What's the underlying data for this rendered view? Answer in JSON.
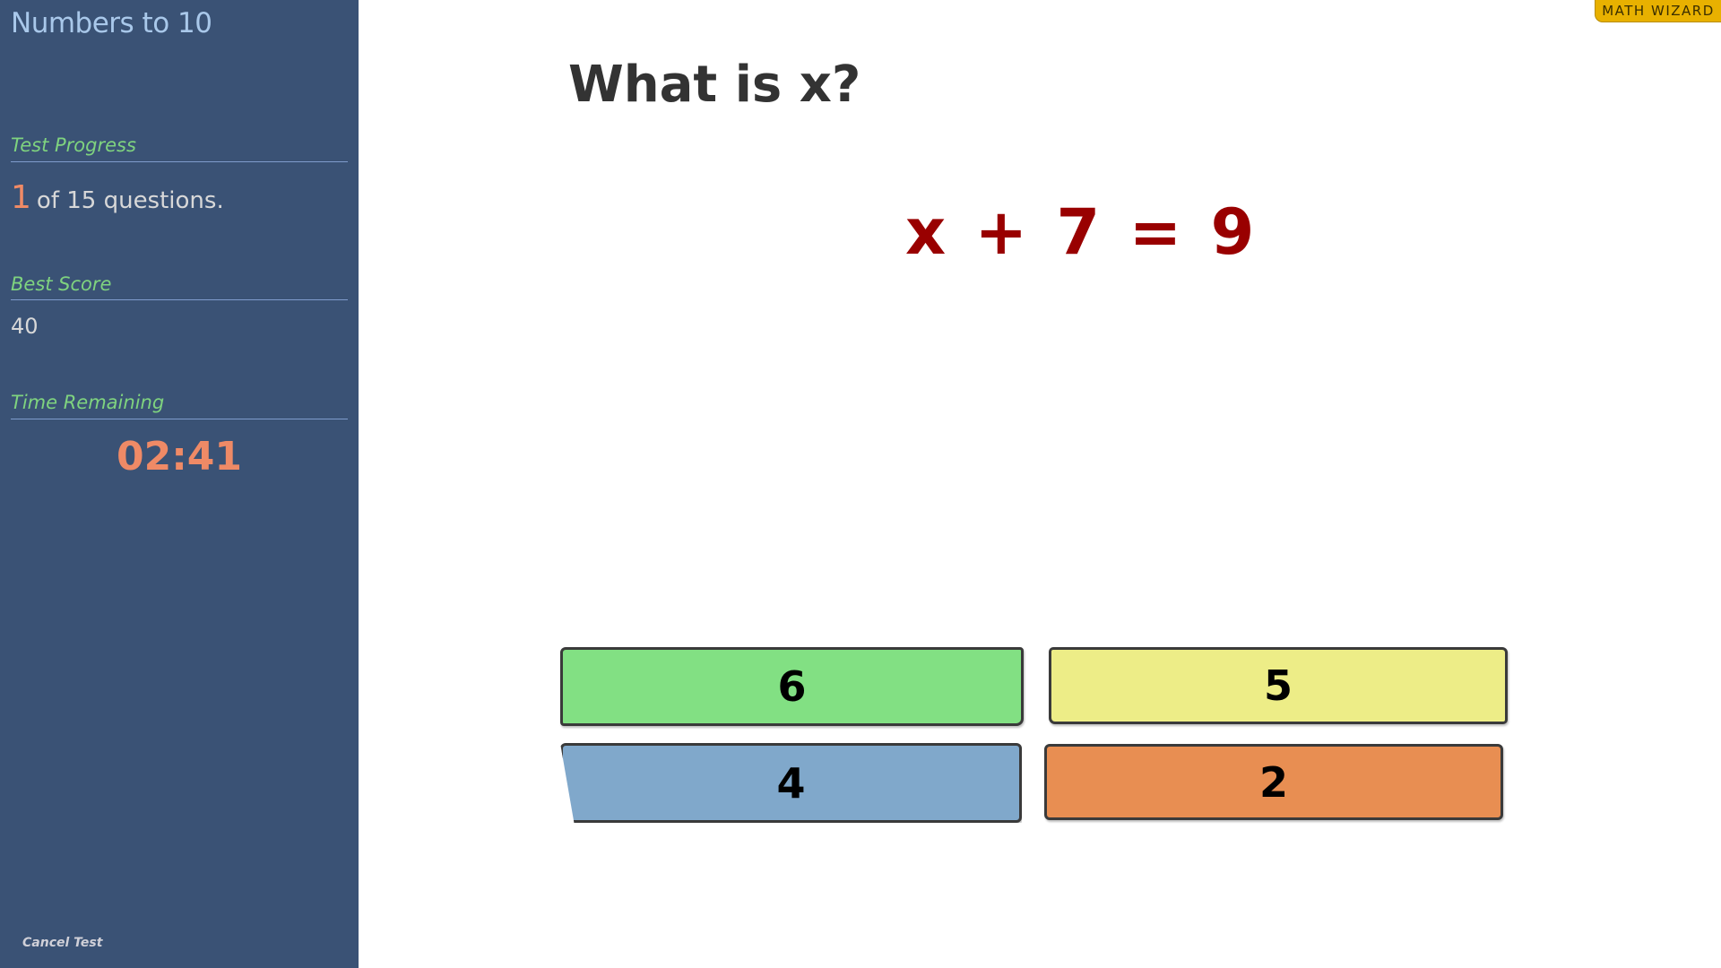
{
  "sidebar": {
    "title": "Numbers to 10",
    "progress": {
      "label": "Test Progress",
      "current": "1",
      "suffix": "of 15 questions."
    },
    "best_score": {
      "label": "Best Score",
      "value": "40"
    },
    "time": {
      "label": "Time Remaining",
      "value": "02:41"
    },
    "cancel_label": "Cancel Test"
  },
  "badge": "MATH WIZARD",
  "main": {
    "question": "What is x?",
    "equation": "x + 7 = 9",
    "answers": [
      {
        "label": "6",
        "color": "#82e083"
      },
      {
        "label": "5",
        "color": "#eded87"
      },
      {
        "label": "4",
        "color": "#80a8cb"
      },
      {
        "label": "2",
        "color": "#e88e52"
      }
    ]
  }
}
